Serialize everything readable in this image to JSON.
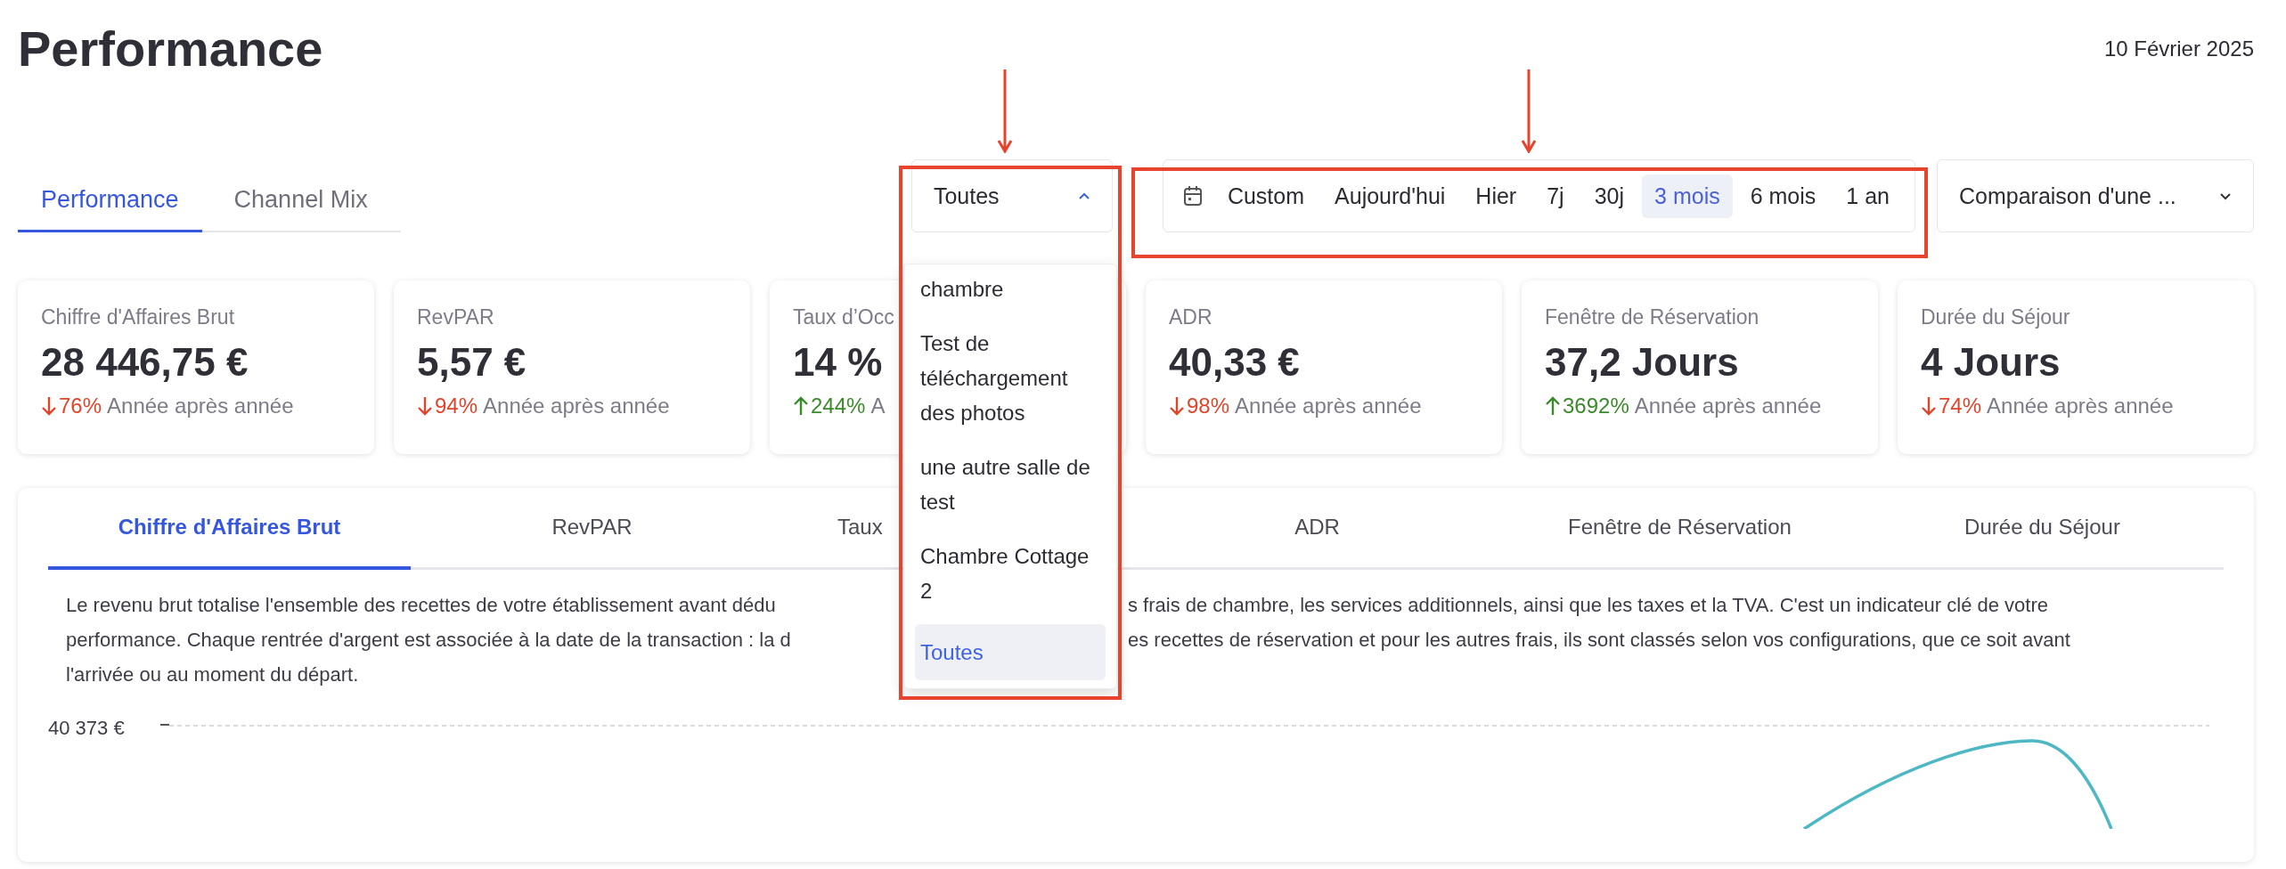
{
  "header": {
    "title": "Performance",
    "date": "10 Février 2025"
  },
  "view_tabs": [
    {
      "label": "Performance",
      "selected": true
    },
    {
      "label": "Channel Mix",
      "selected": false
    }
  ],
  "room_filter": {
    "value": "Toutes",
    "expanded": true,
    "options": [
      {
        "label": "chambre",
        "selected": false
      },
      {
        "label": "Test de téléchargement des photos",
        "selected": false
      },
      {
        "label": "une autre salle de test",
        "selected": false
      },
      {
        "label": "Chambre Cottage 2",
        "selected": false
      },
      {
        "label": "Toutes",
        "selected": true
      }
    ]
  },
  "date_range": [
    {
      "label": "Custom",
      "selected": false
    },
    {
      "label": "Aujourd'hui",
      "selected": false
    },
    {
      "label": "Hier",
      "selected": false
    },
    {
      "label": "7j",
      "selected": false
    },
    {
      "label": "30j",
      "selected": false
    },
    {
      "label": "3 mois",
      "selected": true
    },
    {
      "label": "6 mois",
      "selected": false
    },
    {
      "label": "1 an",
      "selected": false
    }
  ],
  "comparison": {
    "value": "Comparaison d'une ..."
  },
  "kpis": [
    {
      "label": "Chiffre d'Affaires Brut",
      "value": "28 446,75 €",
      "up": false,
      "change": "76%",
      "caption": "Année après année"
    },
    {
      "label": "RevPAR",
      "value": "5,57 €",
      "up": false,
      "change": "94%",
      "caption": "Année après année"
    },
    {
      "label": "Taux d’Occ",
      "value": "14 %",
      "up": true,
      "change": "244%",
      "caption": "A"
    },
    {
      "label": "ADR",
      "value": "40,33 €",
      "up": false,
      "change": "98%",
      "caption": "Année après année"
    },
    {
      "label": "Fenêtre de Réservation",
      "value": "37,2 Jours",
      "up": true,
      "change": "3692%",
      "caption": "Année après année"
    },
    {
      "label": "Durée du Séjour",
      "value": "4 Jours",
      "up": false,
      "change": "74%",
      "caption": "Année après année"
    }
  ],
  "metric_tabs": [
    {
      "label": "Chiffre d'Affaires Brut",
      "selected": true,
      "clipped": false
    },
    {
      "label": "RevPAR",
      "selected": false,
      "clipped": false
    },
    {
      "label": "Taux",
      "selected": false,
      "clipped": true
    },
    {
      "label": "ADR",
      "selected": false,
      "clipped": false
    },
    {
      "label": "Fenêtre de Réservation",
      "selected": false,
      "clipped": false
    },
    {
      "label": "Durée du Séjour",
      "selected": false,
      "clipped": false
    }
  ],
  "description": [
    {
      "left": "Le revenu brut totalise l'ensemble des recettes de votre établissement avant dédu",
      "right": "s frais de chambre, les services additionnels, ainsi que les taxes et la TVA. C'est un indicateur clé de votre"
    },
    {
      "left": "performance. Chaque rentrée d'argent est associée à la date de la transaction : la d",
      "right": "es recettes de réservation et pour les autres frais, ils sont classés selon vos configurations, que ce soit avant"
    },
    {
      "left": "l'arrivée ou au moment du départ."
    }
  ],
  "chart": {
    "y_label": "40 373 €"
  }
}
